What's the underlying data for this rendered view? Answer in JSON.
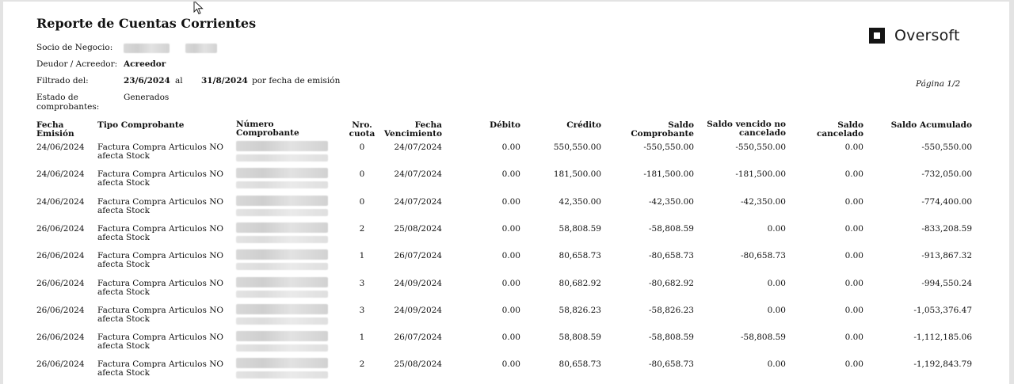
{
  "report": {
    "title": "Reporte de Cuentas Corrientes",
    "socio_label": "Socio de Negocio:",
    "deudor_label": "Deudor / Acreedor:",
    "deudor_value": "Acreedor",
    "filtrado_label": "Filtrado del:",
    "fecha_desde": "23/6/2024",
    "al_label": "al",
    "fecha_hasta": "31/8/2024",
    "filtro_tipo": "por fecha de emisión",
    "estado_label_1": "Estado de",
    "estado_label_2": "comprobantes:",
    "estado_value": "Generados",
    "pagina": "Página 1/2"
  },
  "logo": {
    "text": "Oversoft"
  },
  "columns": {
    "fecha_emision_1": "Fecha",
    "fecha_emision_2": "Emisión",
    "tipo": "Tipo Comprobante",
    "numero_1": "Número",
    "numero_2": "Comprobante",
    "cuota_1": "Nro.",
    "cuota_2": "cuota",
    "venc_1": "Fecha",
    "venc_2": "Vencimiento",
    "debito": "Débito",
    "credito": "Crédito",
    "saldo_comp_1": "Saldo",
    "saldo_comp_2": "Comprobante",
    "vencido_1": "Saldo vencido no",
    "vencido_2": "cancelado",
    "cancelado_1": "Saldo",
    "cancelado_2": "cancelado",
    "acumulado": "Saldo Acumulado"
  },
  "rows": [
    {
      "fecha": "24/06/2024",
      "tipo_1": "Factura Compra Articulos NO",
      "tipo_2": "afecta Stock",
      "cuota": "0",
      "venc": "24/07/2024",
      "debito": "0.00",
      "credito": "550,550.00",
      "saldo": "-550,550.00",
      "vencido": "-550,550.00",
      "cancelado": "0.00",
      "acumulado": "-550,550.00"
    },
    {
      "fecha": "24/06/2024",
      "tipo_1": "Factura Compra Articulos NO",
      "tipo_2": "afecta Stock",
      "cuota": "0",
      "venc": "24/07/2024",
      "debito": "0.00",
      "credito": "181,500.00",
      "saldo": "-181,500.00",
      "vencido": "-181,500.00",
      "cancelado": "0.00",
      "acumulado": "-732,050.00"
    },
    {
      "fecha": "24/06/2024",
      "tipo_1": "Factura Compra Articulos NO",
      "tipo_2": "afecta Stock",
      "cuota": "0",
      "venc": "24/07/2024",
      "debito": "0.00",
      "credito": "42,350.00",
      "saldo": "-42,350.00",
      "vencido": "-42,350.00",
      "cancelado": "0.00",
      "acumulado": "-774,400.00"
    },
    {
      "fecha": "26/06/2024",
      "tipo_1": "Factura Compra Articulos NO",
      "tipo_2": "afecta Stock",
      "cuota": "2",
      "venc": "25/08/2024",
      "debito": "0.00",
      "credito": "58,808.59",
      "saldo": "-58,808.59",
      "vencido": "0.00",
      "cancelado": "0.00",
      "acumulado": "-833,208.59"
    },
    {
      "fecha": "26/06/2024",
      "tipo_1": "Factura Compra Articulos NO",
      "tipo_2": "afecta Stock",
      "cuota": "1",
      "venc": "26/07/2024",
      "debito": "0.00",
      "credito": "80,658.73",
      "saldo": "-80,658.73",
      "vencido": "-80,658.73",
      "cancelado": "0.00",
      "acumulado": "-913,867.32"
    },
    {
      "fecha": "26/06/2024",
      "tipo_1": "Factura Compra Articulos NO",
      "tipo_2": "afecta Stock",
      "cuota": "3",
      "venc": "24/09/2024",
      "debito": "0.00",
      "credito": "80,682.92",
      "saldo": "-80,682.92",
      "vencido": "0.00",
      "cancelado": "0.00",
      "acumulado": "-994,550.24"
    },
    {
      "fecha": "26/06/2024",
      "tipo_1": "Factura Compra Articulos NO",
      "tipo_2": "afecta Stock",
      "cuota": "3",
      "venc": "24/09/2024",
      "debito": "0.00",
      "credito": "58,826.23",
      "saldo": "-58,826.23",
      "vencido": "0.00",
      "cancelado": "0.00",
      "acumulado": "-1,053,376.47"
    },
    {
      "fecha": "26/06/2024",
      "tipo_1": "Factura Compra Articulos NO",
      "tipo_2": "afecta Stock",
      "cuota": "1",
      "venc": "26/07/2024",
      "debito": "0.00",
      "credito": "58,808.59",
      "saldo": "-58,808.59",
      "vencido": "-58,808.59",
      "cancelado": "0.00",
      "acumulado": "-1,112,185.06"
    },
    {
      "fecha": "26/06/2024",
      "tipo_1": "Factura Compra Articulos NO",
      "tipo_2": "afecta Stock",
      "cuota": "2",
      "venc": "25/08/2024",
      "debito": "0.00",
      "credito": "80,658.73",
      "saldo": "-80,658.73",
      "vencido": "0.00",
      "cancelado": "0.00",
      "acumulado": "-1,192,843.79"
    }
  ]
}
